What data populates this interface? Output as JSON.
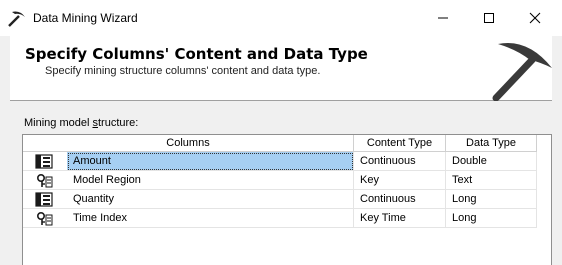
{
  "window": {
    "title": "Data Mining Wizard"
  },
  "header": {
    "title": "Specify Columns' Content and Data Type",
    "subtitle": "Specify mining structure columns' content and data type."
  },
  "section": {
    "label_prefix": "Mining model ",
    "label_mnemonic": "s",
    "label_suffix": "tructure:"
  },
  "grid": {
    "headers": [
      "Columns",
      "Content Type",
      "Data Type"
    ],
    "rows": [
      {
        "name": "Amount",
        "content_type": "Continuous",
        "data_type": "Double",
        "icon": "column-table-icon",
        "selected": true
      },
      {
        "name": "Model Region",
        "content_type": "Key",
        "data_type": "Text",
        "icon": "key-column-icon",
        "selected": false
      },
      {
        "name": "Quantity",
        "content_type": "Continuous",
        "data_type": "Long",
        "icon": "column-table-icon",
        "selected": false
      },
      {
        "name": "Time Index",
        "content_type": "Key Time",
        "data_type": "Long",
        "icon": "key-column-icon",
        "selected": false
      }
    ]
  },
  "colors": {
    "selection": "#a6cff2",
    "header_bg": "#ffffff",
    "window_bg": "#f0f0f0"
  }
}
